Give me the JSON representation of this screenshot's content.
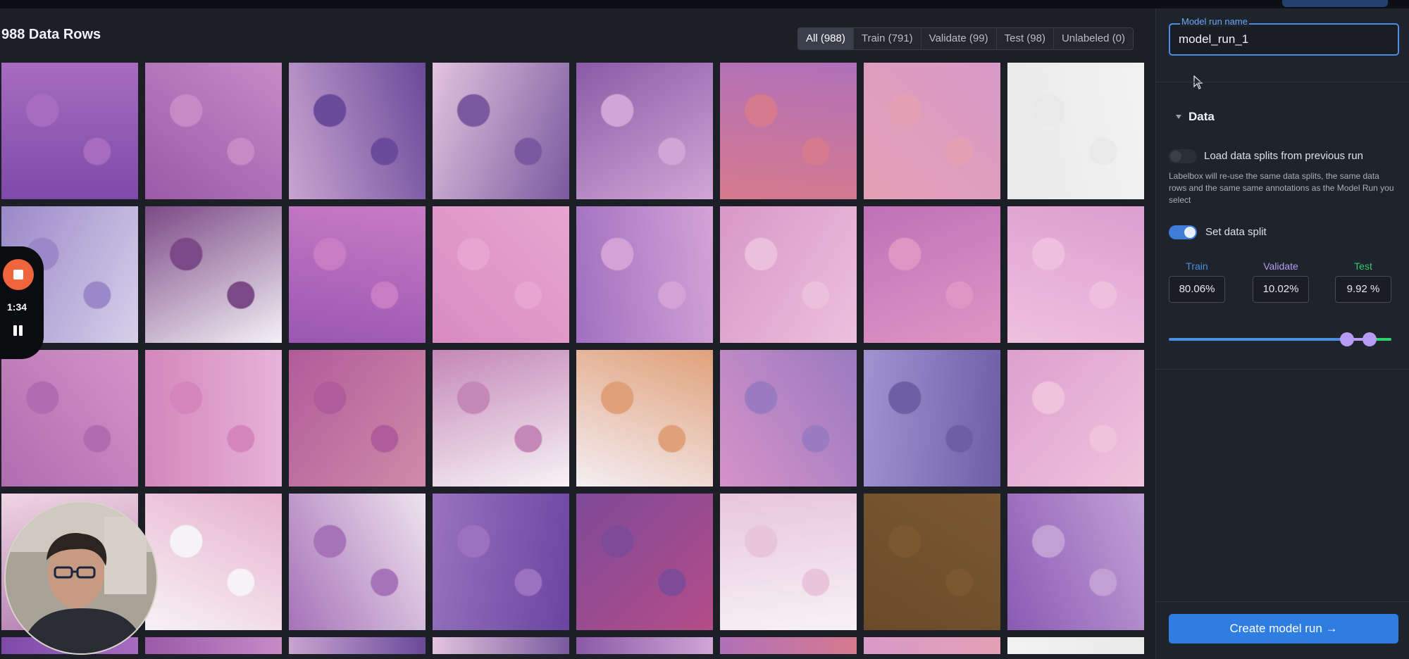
{
  "header": {
    "title": "988 Data Rows",
    "filters": [
      {
        "label": "All (988)",
        "active": true
      },
      {
        "label": "Train (791)",
        "active": false
      },
      {
        "label": "Validate (99)",
        "active": false
      },
      {
        "label": "Test (98)",
        "active": false
      },
      {
        "label": "Unlabeled (0)",
        "active": false
      }
    ]
  },
  "recorder": {
    "time": "1:34"
  },
  "panel": {
    "model_run_label": "Model run name",
    "model_run_value": "model_run_1",
    "section_title": "Data",
    "load_splits_label": "Load data splits from previous run",
    "load_splits_enabled": false,
    "help_text": "Labelbox will re-use the same data splits, the same data rows and the same same annotations as the Model Run you select",
    "set_split_label": "Set data split",
    "set_split_enabled": true,
    "splits": {
      "train_label": "Train",
      "train_value": "80.06%",
      "validate_label": "Validate",
      "validate_value": "10.02%",
      "test_label": "Test",
      "test_value": "9.92 %"
    },
    "split_fractions": {
      "train": 0.8006,
      "validate": 0.1002,
      "test": 0.0992
    },
    "colors": {
      "train": "#4a90e2",
      "validate": "#b79cf4",
      "test": "#2fcf6f"
    },
    "create_button": "Create model run"
  },
  "tiles": [
    [
      "#7e4aa8",
      "#a66cc0"
    ],
    [
      "#9a5aa8",
      "#c58bc6"
    ],
    [
      "#c9a4d0",
      "#6a4a9a"
    ],
    [
      "#e3c3de",
      "#7a5a9e"
    ],
    [
      "#8a5aa6",
      "#d0a6d6"
    ],
    [
      "#b070b8",
      "#d67a8e"
    ],
    [
      "#d89ac8",
      "#e3a0b4"
    ],
    [
      "#f2f2f2",
      "#e9e9ea"
    ],
    [
      "#d6d0ea",
      "#9a88c8"
    ],
    [
      "#f4f1f6",
      "#7b4a86"
    ],
    [
      "#9a56b2",
      "#c77cc4"
    ],
    [
      "#d98ac2",
      "#e6a6d0"
    ],
    [
      "#a070c0",
      "#d4a2d6"
    ],
    [
      "#d897c8",
      "#ecc0dc"
    ],
    [
      "#c070b8",
      "#e095c4"
    ],
    [
      "#dc9ed0",
      "#efc0de"
    ],
    [
      "#d394c8",
      "#b06cb0"
    ],
    [
      "#e6b3d8",
      "#d486bc"
    ],
    [
      "#d08aa8",
      "#b05c9a"
    ],
    [
      "#f7f3f5",
      "#c487b8"
    ],
    [
      "#f4eef3",
      "#e0a17a"
    ],
    [
      "#d592c8",
      "#9a7ac0"
    ],
    [
      "#a193d0",
      "#6d5ea8"
    ],
    [
      "#dca0cf",
      "#f0c3dc"
    ],
    [
      "#f0d5e2",
      "#b17ab0"
    ],
    [
      "#e6b0cc",
      "#f7f2f5"
    ],
    [
      "#eee3ee",
      "#a672b8"
    ],
    [
      "#6a44a0",
      "#9a72c0"
    ],
    [
      "#b44c88",
      "#7e4a98"
    ],
    [
      "#f7f2f5",
      "#e8c5dc"
    ],
    [
      "#6a4a2a",
      "#7b5830"
    ],
    [
      "#8a5ab4",
      "#c2a0d6"
    ]
  ]
}
